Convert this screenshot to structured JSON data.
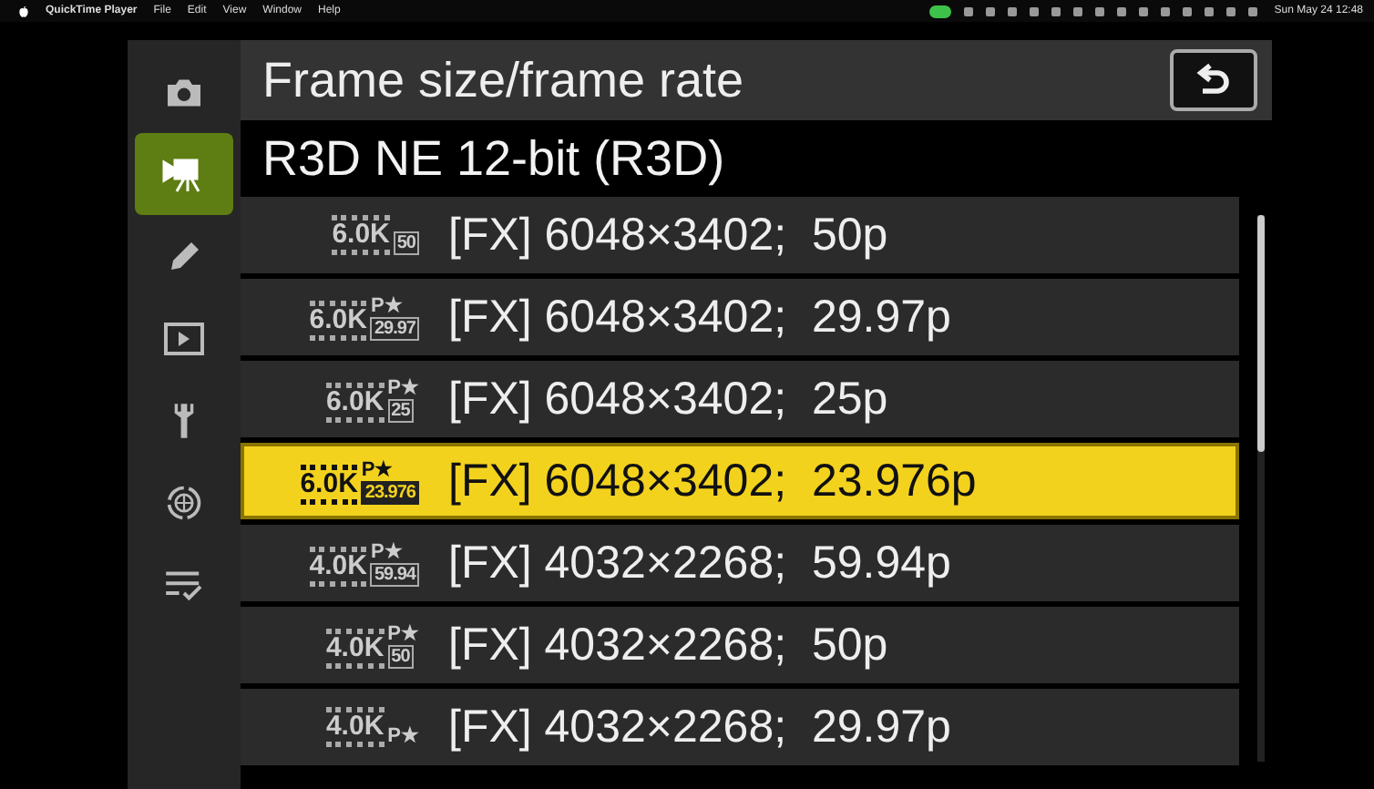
{
  "menu_bar": {
    "app": "QuickTime Player",
    "items": [
      "File",
      "Edit",
      "View",
      "Window",
      "Help"
    ],
    "clock": "Sun May 24 12:48"
  },
  "sidebar": {
    "items": [
      {
        "kind": "camera",
        "selected": false
      },
      {
        "kind": "movie",
        "selected": true
      },
      {
        "kind": "pencil",
        "selected": false
      },
      {
        "kind": "play",
        "selected": false
      },
      {
        "kind": "wrench",
        "selected": false
      },
      {
        "kind": "network",
        "selected": false
      },
      {
        "kind": "checklist",
        "selected": false
      }
    ]
  },
  "title": "Frame size/frame rate",
  "subtitle": "R3D NE 12-bit (R3D)",
  "rows": [
    {
      "resolution": "6.0K",
      "rate": "50",
      "label": "[FX] 6048×3402;  50p",
      "selected": false
    },
    {
      "resolution": "6.0K",
      "star": "P★",
      "rate": "29.97",
      "label": "[FX] 6048×3402;  29.97p",
      "selected": false
    },
    {
      "resolution": "6.0K",
      "star": "P★",
      "rate": "25",
      "label": "[FX] 6048×3402;  25p",
      "selected": false
    },
    {
      "resolution": "6.0K",
      "star": "P★",
      "rate": "23.976",
      "label": "[FX] 6048×3402;  23.976p",
      "selected": true
    },
    {
      "resolution": "4.0K",
      "star": "P★",
      "rate": "59.94",
      "label": "[FX] 4032×2268;  59.94p",
      "selected": false
    },
    {
      "resolution": "4.0K",
      "star": "P★",
      "rate": "50",
      "label": "[FX] 4032×2268;  50p",
      "selected": false
    },
    {
      "resolution": "4.0K",
      "star": "P★",
      "label": "[FX] 4032×2268;  29.97p",
      "selected": false
    }
  ]
}
